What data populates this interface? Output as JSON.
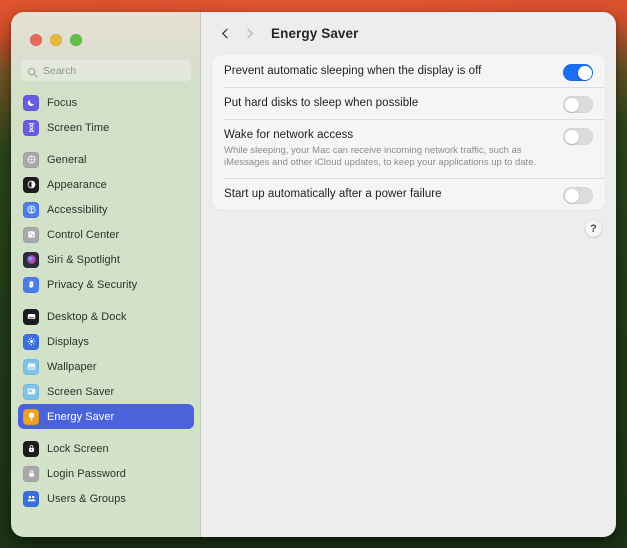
{
  "window": {
    "traffic_lights": [
      {
        "name": "close",
        "color": "#e8695c"
      },
      {
        "name": "minimize",
        "color": "#e9b63e"
      },
      {
        "name": "zoom",
        "color": "#64bd4b"
      }
    ]
  },
  "sidebar": {
    "search": {
      "placeholder": "Search",
      "value": ""
    },
    "groups": [
      {
        "items": [
          {
            "label": "Focus",
            "icon": "moon-icon",
            "color": "#6a5ae0",
            "selected": false
          },
          {
            "label": "Screen Time",
            "icon": "hourglass-icon",
            "color": "#6a5ae0",
            "selected": false
          }
        ]
      },
      {
        "items": [
          {
            "label": "General",
            "icon": "gear-icon",
            "color": "#a9a9ab",
            "selected": false
          },
          {
            "label": "Appearance",
            "icon": "appearance-icon",
            "color": "#1c1c1e",
            "selected": false
          },
          {
            "label": "Accessibility",
            "icon": "accessibility-icon",
            "color": "#4a7de8",
            "selected": false
          },
          {
            "label": "Control Center",
            "icon": "control-center-icon",
            "color": "#a9a9ab",
            "selected": false
          },
          {
            "label": "Siri & Spotlight",
            "icon": "siri-icon",
            "color": "#2b2b3a",
            "selected": false
          },
          {
            "label": "Privacy & Security",
            "icon": "hand-raised-icon",
            "color": "#4a7de8",
            "selected": false
          }
        ]
      },
      {
        "items": [
          {
            "label": "Desktop & Dock",
            "icon": "desktop-dock-icon",
            "color": "#1c1c1e",
            "selected": false
          },
          {
            "label": "Displays",
            "icon": "display-brightness-icon",
            "color": "#3b6fe0",
            "selected": false
          },
          {
            "label": "Wallpaper",
            "icon": "wallpaper-icon",
            "color": "#7fc4e8",
            "selected": false
          },
          {
            "label": "Screen Saver",
            "icon": "screen-saver-icon",
            "color": "#7fc4e8",
            "selected": false
          },
          {
            "label": "Energy Saver",
            "icon": "lightbulb-icon",
            "color": "#f0a124",
            "selected": true
          }
        ]
      },
      {
        "items": [
          {
            "label": "Lock Screen",
            "icon": "lock-screen-icon",
            "color": "#1c1c1e",
            "selected": false
          },
          {
            "label": "Login Password",
            "icon": "login-password-icon",
            "color": "#a9a9ab",
            "selected": false
          },
          {
            "label": "Users & Groups",
            "icon": "users-groups-icon",
            "color": "#3b6fe0",
            "selected": false
          }
        ]
      }
    ]
  },
  "toolbar": {
    "back_icon": "chevron-left-icon",
    "forward_icon": "chevron-right-icon",
    "title": "Energy Saver"
  },
  "settings": {
    "rows": [
      {
        "label": "Prevent automatic sleeping when the display is off",
        "description": "",
        "toggle": "on"
      },
      {
        "label": "Put hard disks to sleep when possible",
        "description": "",
        "toggle": "off"
      },
      {
        "label": "Wake for network access",
        "description": "While sleeping, your Mac can receive incoming network traffic, such as iMessages and other iCloud updates, to keep your applications up to date.",
        "toggle": "off"
      },
      {
        "label": "Start up automatically after a power failure",
        "description": "",
        "toggle": "off"
      }
    ],
    "help_label": "?"
  },
  "colors": {
    "accent_toggle_on": "#1b6ef3",
    "sidebar_selection": "#4a63d8",
    "panel_bg": "#f6f5f5",
    "content_bg": "#eeeded"
  }
}
